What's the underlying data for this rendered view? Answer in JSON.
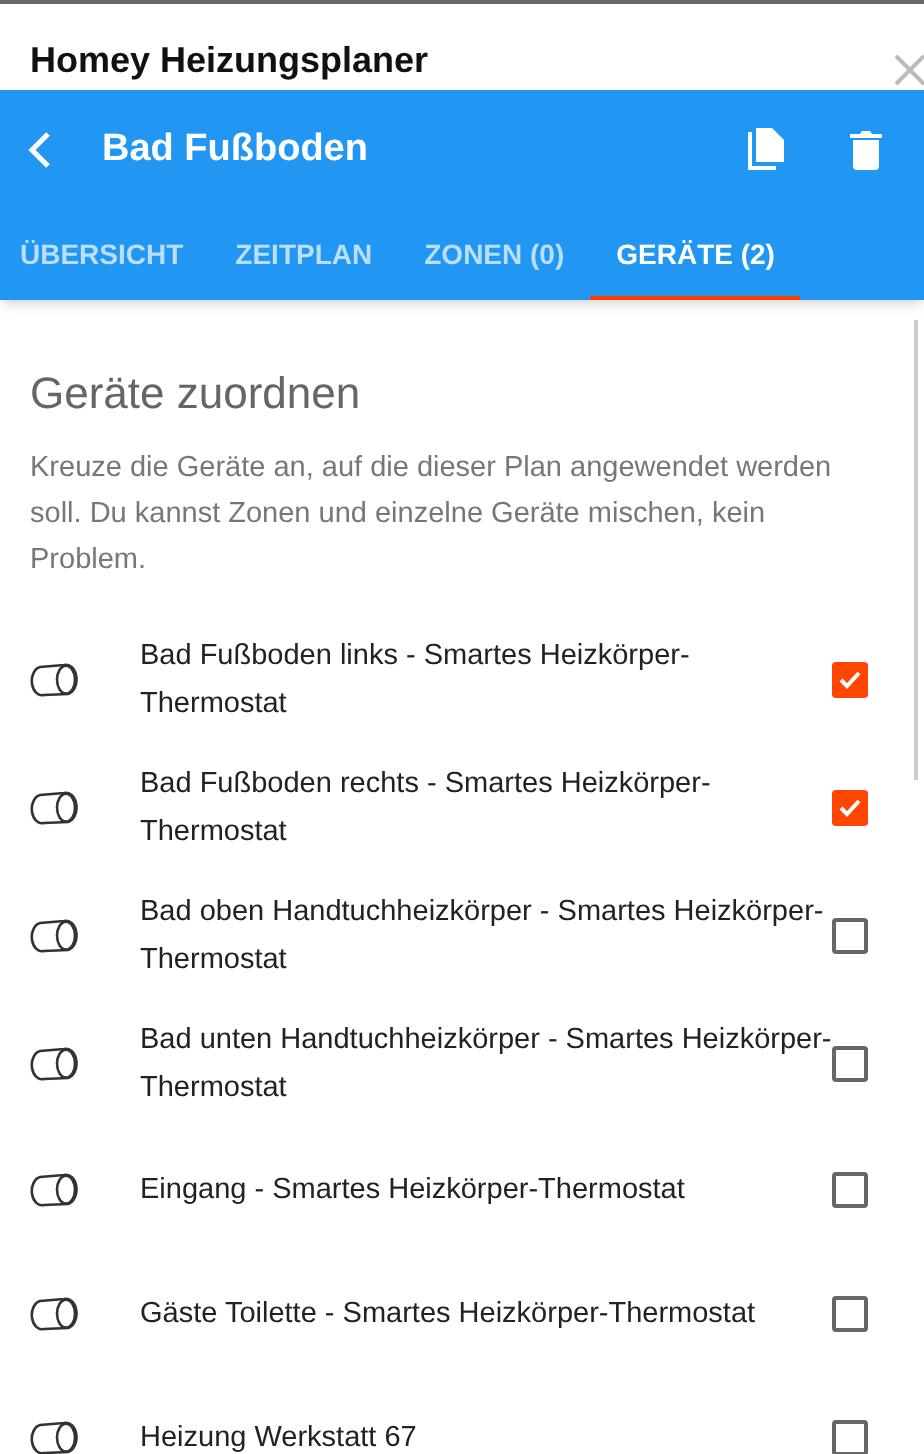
{
  "window": {
    "title": "Homey Heizungsplaner"
  },
  "toolbar": {
    "title": "Bad Fußboden"
  },
  "tabs": [
    {
      "label": "ÜBERSICHT",
      "selected": false
    },
    {
      "label": "ZEITPLAN",
      "selected": false
    },
    {
      "label": "ZONEN (0)",
      "selected": false
    },
    {
      "label": "GERÄTE (2)",
      "selected": true
    }
  ],
  "section": {
    "heading": "Geräte zuordnen",
    "description": "Kreuze die Geräte an, auf die dieser Plan angewendet werden soll. Du kannst Zonen und einzelne Geräte mischen, kein Problem."
  },
  "devices": [
    {
      "name": "Bad Fußboden links - Smartes Heizkörper-Thermostat",
      "checked": true
    },
    {
      "name": "Bad Fußboden rechts - Smartes Heizkörper-Thermostat",
      "checked": true
    },
    {
      "name": "Bad oben Handtuchheizkörper - Smartes Heizkörper-Thermostat",
      "checked": false
    },
    {
      "name": "Bad unten Handtuchheizkörper - Smartes Heizkörper-Thermostat",
      "checked": false
    },
    {
      "name": "Eingang - Smartes Heizkörper-Thermostat",
      "checked": false
    },
    {
      "name": "Gäste Toilette - Smartes Heizkörper-Thermostat",
      "checked": false
    },
    {
      "name": "Heizung Werkstatt 67",
      "checked": false
    }
  ]
}
